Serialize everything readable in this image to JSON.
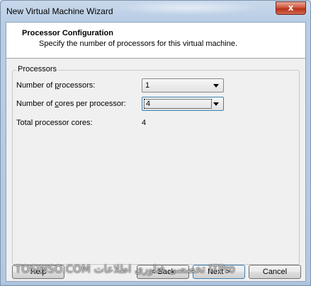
{
  "window": {
    "title": "New Virtual Machine Wizard",
    "close_glyph": "x"
  },
  "header": {
    "title": "Processor Configuration",
    "subtitle": "Specify the number of processors for this virtual machine."
  },
  "processors_group": {
    "legend": "Processors",
    "num_processors": {
      "label_pre": "Number of ",
      "label_key": "p",
      "label_post": "rocessors:",
      "value": "1"
    },
    "cores_per_processor": {
      "label_pre": "Number of ",
      "label_key": "c",
      "label_post": "ores per processor:",
      "value": "4"
    },
    "total_cores": {
      "label": "Total processor cores:",
      "value": "4"
    }
  },
  "buttons": {
    "help": "Help",
    "back": "< Back",
    "next": "Next >",
    "cancel": "Cancel"
  },
  "watermark": "TOSINSO.COM  تخصصی فناوری اطلاعات  ITPro"
}
